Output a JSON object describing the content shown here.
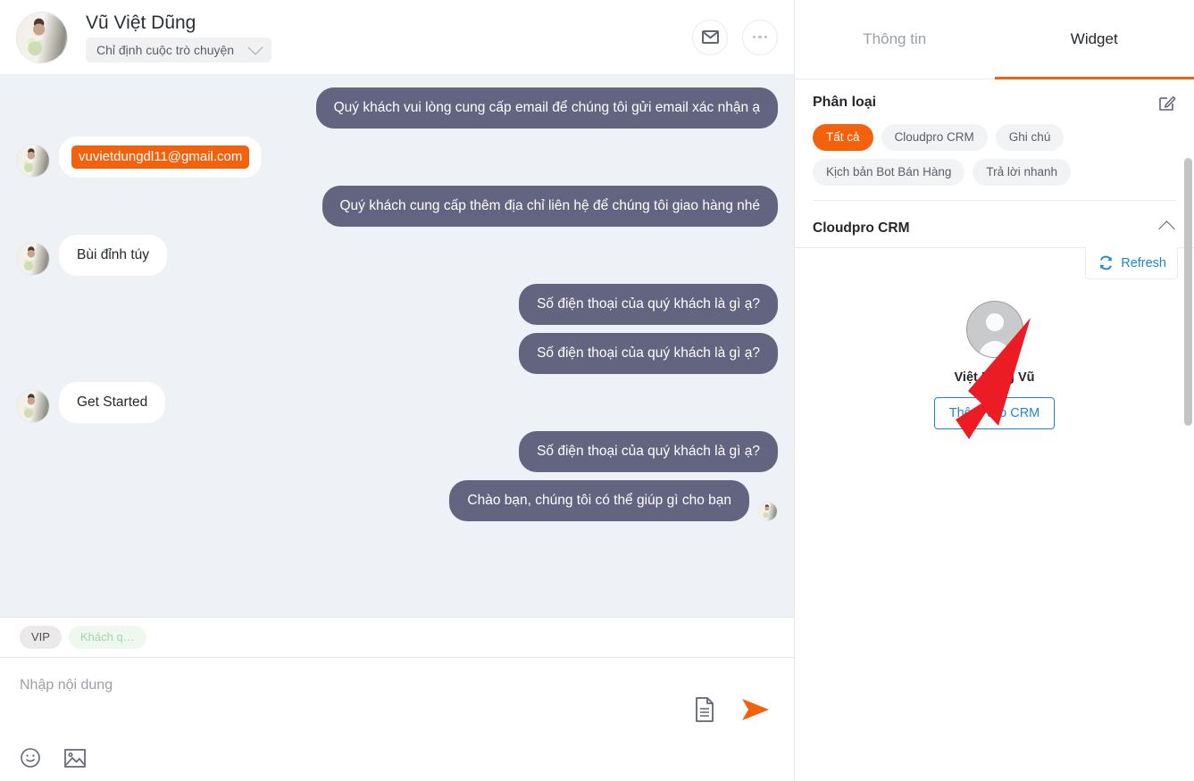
{
  "chat": {
    "header": {
      "contact_name": "Vũ Việt Dũng",
      "assign_label": "Chỉ định cuộc trò chuyện",
      "mail_icon": "envelope-icon",
      "more_icon": "ellipsis-icon"
    },
    "messages": [
      {
        "side": "out",
        "text": "Quý khách vui lòng cung cấp email để chúng tôi gửi email xác nhận ạ",
        "type": "text"
      },
      {
        "side": "in",
        "text": "vuvietdungdl11@gmail.com",
        "type": "email"
      },
      {
        "side": "out",
        "text": "Quý khách cung cấp thêm địa chỉ liên hệ để chúng tôi giao hàng nhé",
        "type": "text"
      },
      {
        "side": "in",
        "text": "Bùi đỉnh túy",
        "type": "text"
      },
      {
        "side": "out",
        "text": "Số điện thoại của quý khách là gì ạ?",
        "type": "text"
      },
      {
        "side": "out",
        "text": "Số điện thoại của quý khách là gì ạ?",
        "type": "text"
      },
      {
        "side": "in",
        "text": "Get Started",
        "type": "text"
      },
      {
        "side": "out",
        "text": "Số điện thoại của quý khách là gì ạ?",
        "type": "text"
      },
      {
        "side": "out",
        "text": "Chào bạn, chúng tôi có thể giúp gì cho bạn",
        "type": "text"
      }
    ],
    "tags": [
      {
        "label": "VIP",
        "style": "grey"
      },
      {
        "label": "Khách q…",
        "style": "green"
      }
    ],
    "composer": {
      "placeholder": "Nhập nội dung",
      "emoji_icon": "smiley-icon",
      "image_icon": "image-icon",
      "template_icon": "document-icon",
      "send_icon": "send-icon"
    }
  },
  "panel": {
    "tabs": [
      {
        "label": "Thông tin",
        "active": false
      },
      {
        "label": "Widget",
        "active": true
      }
    ],
    "classify": {
      "title": "Phân loại",
      "edit_icon": "edit-pencil-icon",
      "chips": [
        {
          "label": "Tất cả",
          "active": true
        },
        {
          "label": "Cloudpro CRM",
          "active": false
        },
        {
          "label": "Ghi chú",
          "active": false
        },
        {
          "label": "Kịch bản Bot Bán Hàng",
          "active": false
        },
        {
          "label": "Trả lời nhanh",
          "active": false
        }
      ]
    },
    "crm": {
      "title": "Cloudpro CRM",
      "collapse_icon": "chevron-up-icon",
      "refresh_label": "Refresh",
      "refresh_icon": "refresh-icon",
      "contact_name": "Việt Dũng Vũ",
      "add_button_label": "Thêm vào CRM",
      "avatar_icon": "user-placeholder-icon"
    }
  },
  "colors": {
    "accent_orange": "#f4610c",
    "bubble_out": "#63647f",
    "link_blue": "#1d84dd",
    "chat_bg": "#eef1f5",
    "annotation_red": "#ec1c24"
  }
}
